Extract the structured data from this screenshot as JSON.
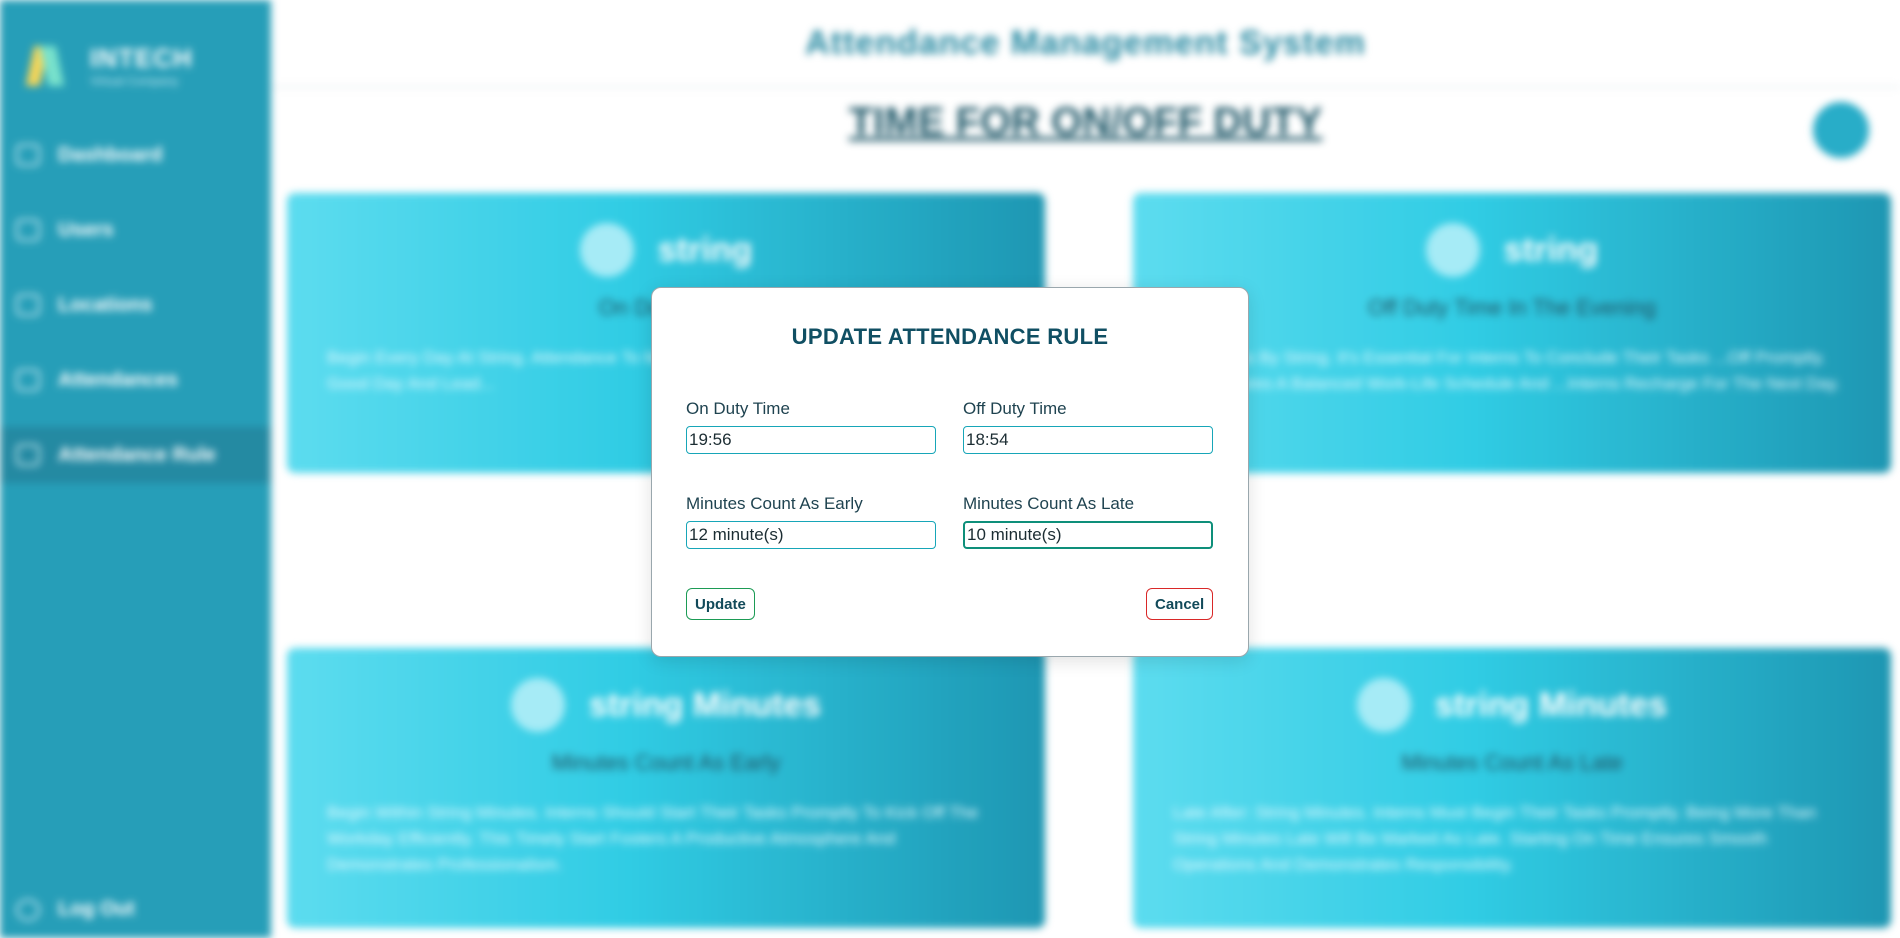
{
  "sidebar": {
    "brand": {
      "name": "INTECH",
      "tagline": "Virtual Company"
    },
    "items": [
      {
        "label": "Dashboard"
      },
      {
        "label": "Users"
      },
      {
        "label": "Locations"
      },
      {
        "label": "Attendances"
      },
      {
        "label": "Attendance Rule"
      }
    ],
    "logout_label": "Log Out"
  },
  "header": {
    "title": "Attendance Management System"
  },
  "main": {
    "section_title": "TIME FOR ON/OFF DUTY",
    "section_title_2_fragment": "S",
    "cards": [
      {
        "value": "string",
        "label": "On Duty Time",
        "description": "Begin Every Day At String. Attendance To Make Sure They're Ready. Everyone Have A Good Day And Lead..."
      },
      {
        "value": "string",
        "label": "Off Duty Time In The Evening",
        "description": "...Activities By String. It's Essential For Interns To Conclude Their Tasks ...Off Promptly. This Ensures A Balanced Work-Life Schedule And ...Interns Recharge For The Next Day."
      },
      {
        "value": "string Minutes",
        "label": "Minutes Count As Early",
        "description": "Begin Within String Minutes. Interns Should Start Their Tasks Promptly To Kick Off The Workday Efficiently. This Timely Start Fosters A Productive Atmosphere And Demonstrates Professionalism."
      },
      {
        "value": "string Minutes",
        "label": "Minutes Count As Late",
        "description": "Late After: String Minutes. Interns Must Begin Their Tasks Promptly. Being More Than String Minutes Late Will Be Marked As Late. Starting On Time Ensures Smooth Operations And Demonstrates Responsibility."
      }
    ]
  },
  "dialog": {
    "title": "UPDATE ATTENDANCE RULE",
    "fields": {
      "on_duty": {
        "label": "On Duty Time",
        "value": "19:56"
      },
      "off_duty": {
        "label": "Off Duty Time",
        "value": "18:54"
      },
      "early": {
        "label": "Minutes Count As Early",
        "value": "12 minute(s)"
      },
      "late": {
        "label": "Minutes Count As Late",
        "value": "10 minute(s)"
      }
    },
    "update_label": "Update",
    "cancel_label": "Cancel"
  },
  "colors": {
    "sidebar": "#1496b2",
    "accent": "#137f9a",
    "update_border": "#1c9b55",
    "cancel_border": "#d92828"
  }
}
